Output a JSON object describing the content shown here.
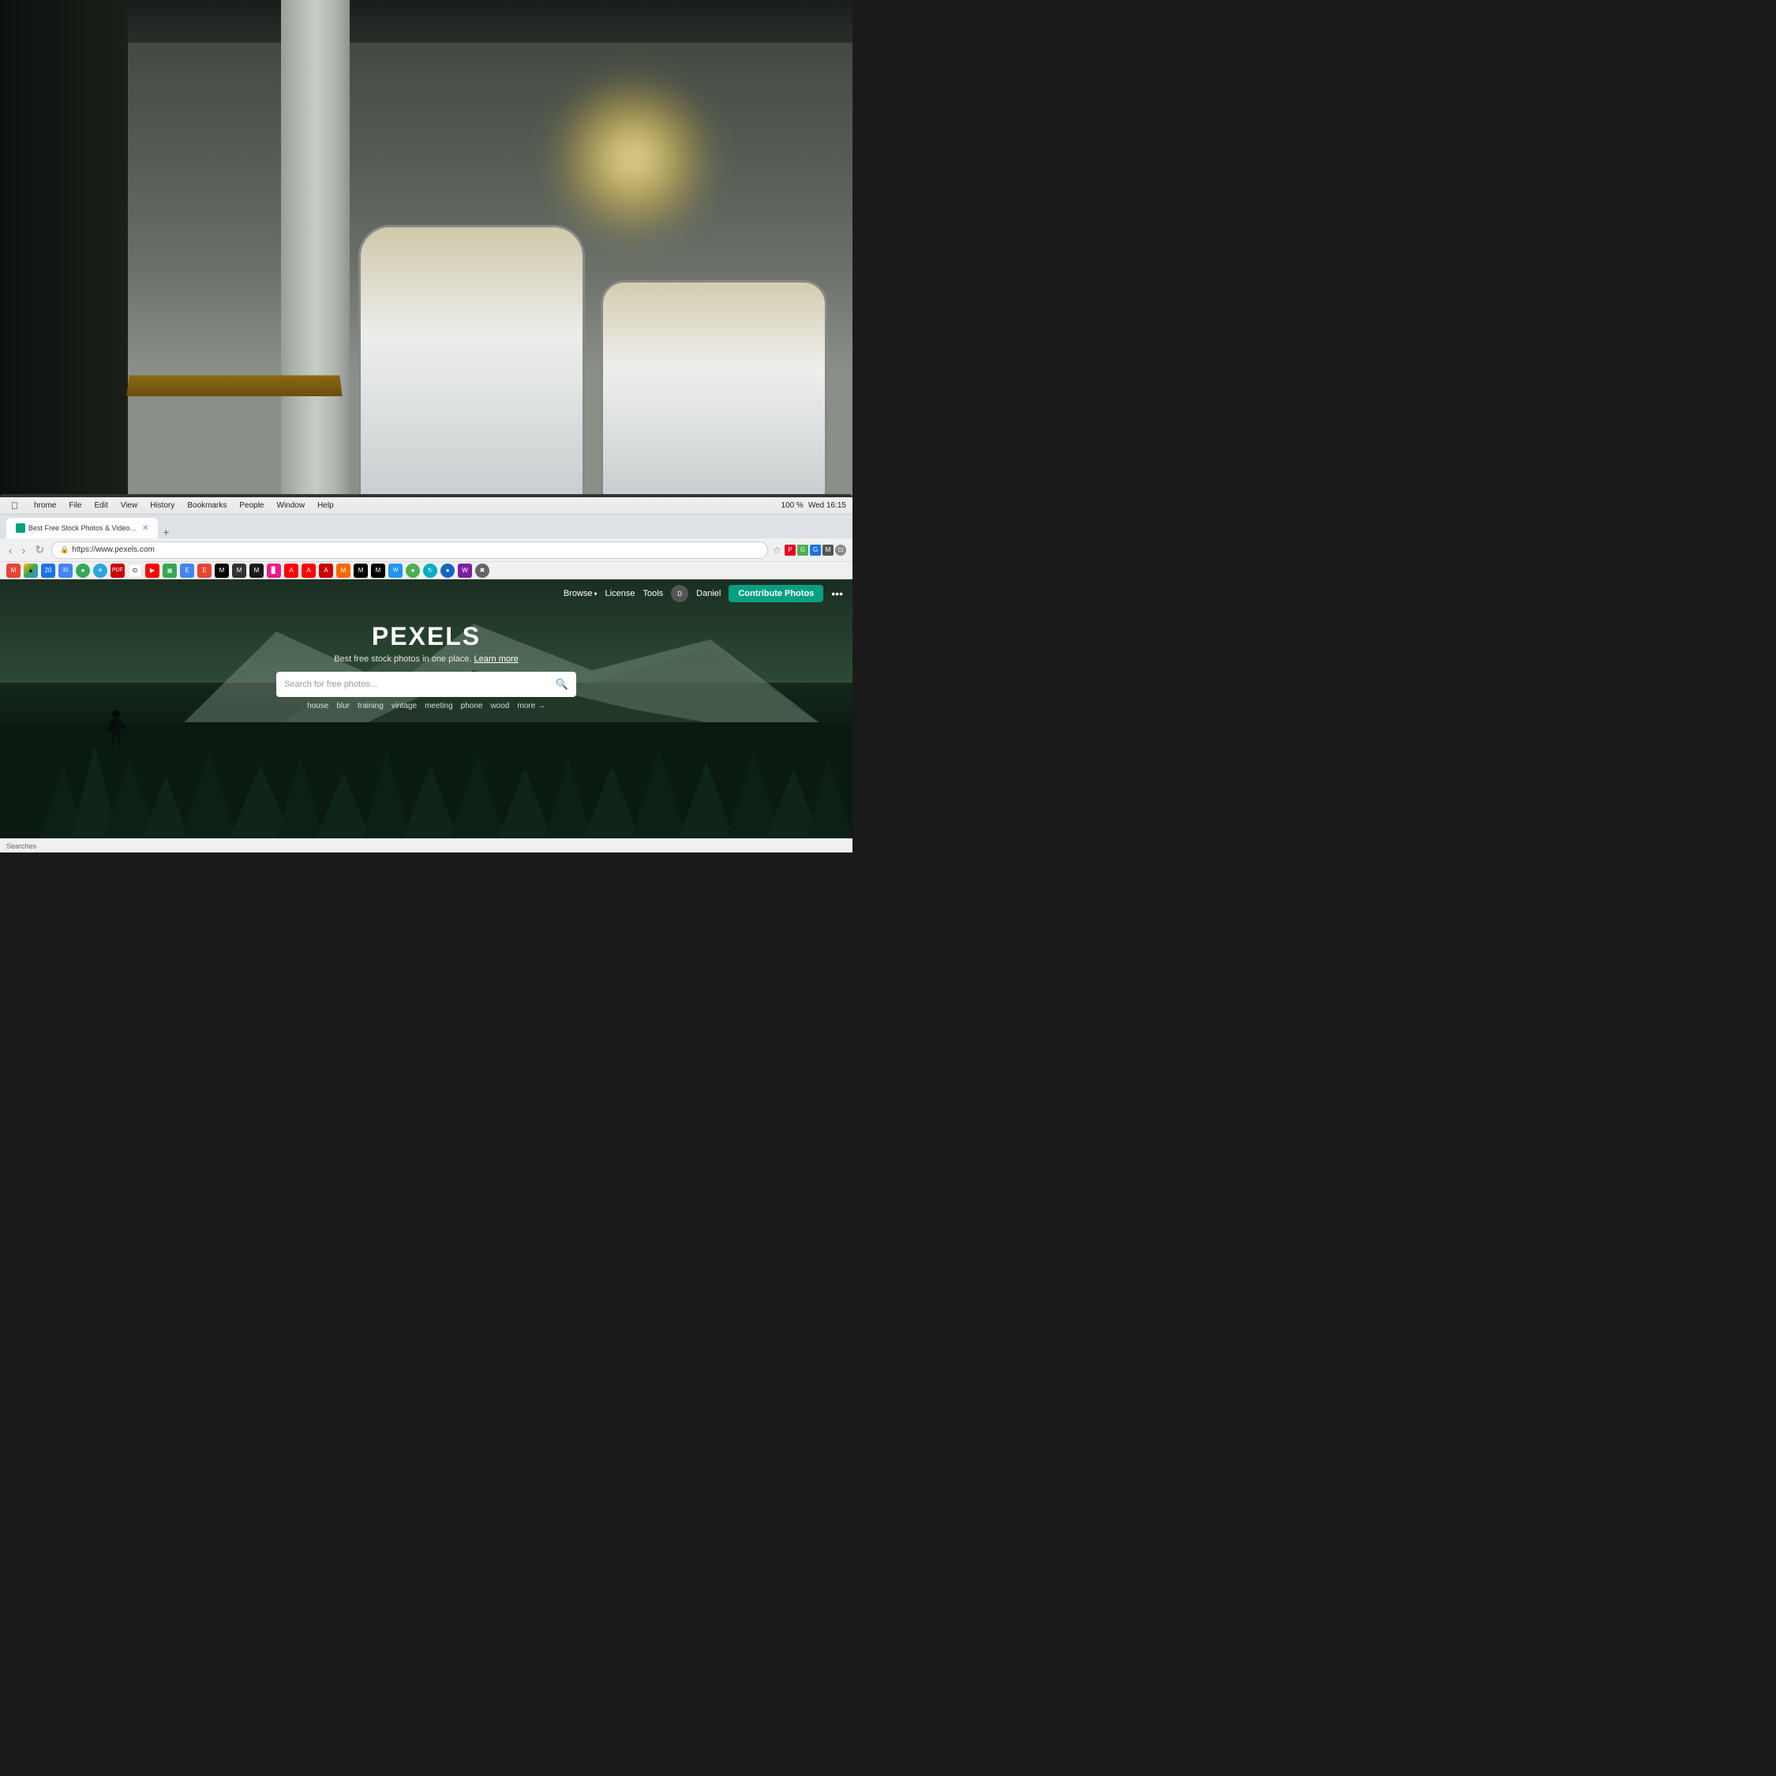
{
  "scene": {
    "background_desc": "Office interior with bokeh sunlight through windows"
  },
  "browser": {
    "tab_title": "Best Free Stock Photos & Videos Shared by Talented Creators",
    "url": "https://www.pexels.com",
    "secure_label": "Secure",
    "time": "Wed 16:15",
    "battery": "100 %"
  },
  "menubar": {
    "apple": "⌘",
    "items": [
      "hrome",
      "File",
      "Edit",
      "View",
      "History",
      "Bookmarks",
      "People",
      "Window",
      "Help"
    ]
  },
  "pexels": {
    "logo": "PEXELS",
    "nav": {
      "browse": "Browse",
      "license": "License",
      "tools": "Tools",
      "user": "Daniel",
      "contribute_button": "Contribute Photos",
      "more_icon": "•••"
    },
    "hero": {
      "title": "PEXELS",
      "subtitle": "Best free stock photos in one place.",
      "learn_more": "Learn more",
      "search_placeholder": "Search for free photos...",
      "tags": [
        "house",
        "blur",
        "training",
        "vintage",
        "meeting",
        "phone",
        "wood"
      ],
      "more_tag": "more →"
    }
  },
  "bottom_bar": {
    "searches_label": "Searches"
  }
}
